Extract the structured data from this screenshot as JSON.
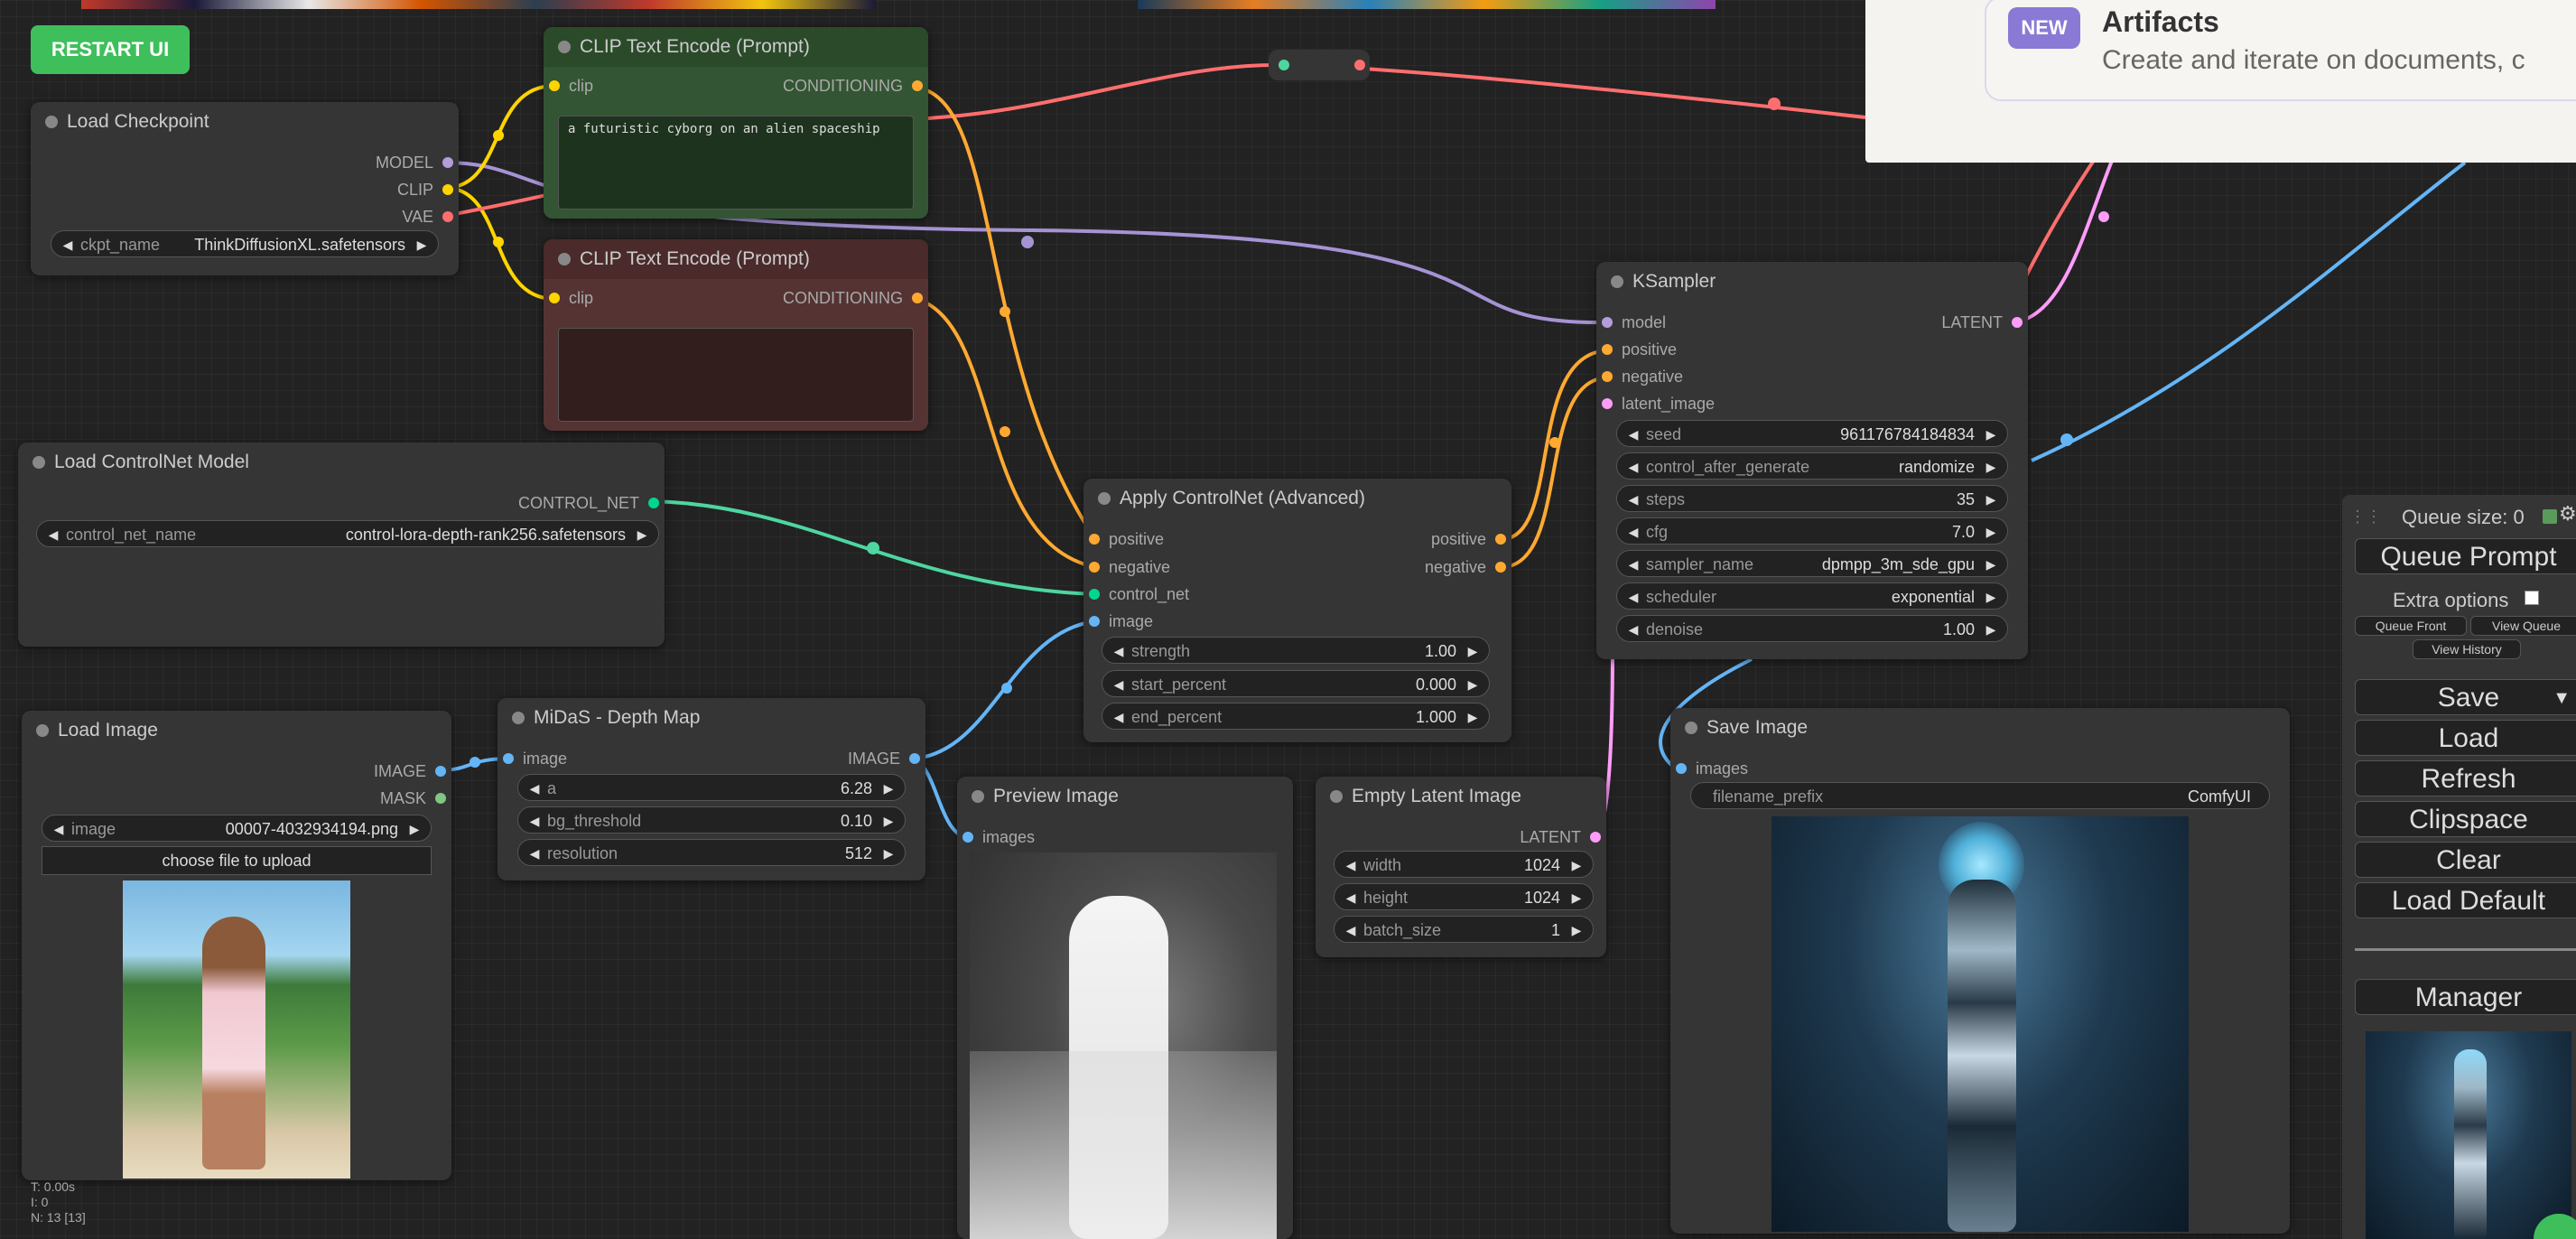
{
  "restart_button": "RESTART UI",
  "artifacts": {
    "badge": "NEW",
    "title": "Artifacts",
    "description": "Create and iterate on documents, c"
  },
  "nodes": {
    "load_checkpoint": {
      "title": "Load Checkpoint",
      "outputs": [
        "MODEL",
        "CLIP",
        "VAE"
      ],
      "widget_name": "ckpt_name",
      "widget_value": "ThinkDiffusionXL.safetensors"
    },
    "clip_pos": {
      "title": "CLIP Text Encode (Prompt)",
      "input": "clip",
      "output": "CONDITIONING",
      "text": "a futuristic cyborg on an alien spaceship"
    },
    "clip_neg": {
      "title": "CLIP Text Encode (Prompt)",
      "input": "clip",
      "output": "CONDITIONING",
      "text": ""
    },
    "load_controlnet": {
      "title": "Load ControlNet Model",
      "output": "CONTROL_NET",
      "widget_name": "control_net_name",
      "widget_value": "control-lora-depth-rank256.safetensors"
    },
    "apply_controlnet": {
      "title": "Apply ControlNet (Advanced)",
      "inputs": [
        "positive",
        "negative",
        "control_net",
        "image"
      ],
      "outputs": [
        "positive",
        "negative"
      ],
      "widgets": [
        {
          "name": "strength",
          "value": "1.00"
        },
        {
          "name": "start_percent",
          "value": "0.000"
        },
        {
          "name": "end_percent",
          "value": "1.000"
        }
      ]
    },
    "ksampler": {
      "title": "KSampler",
      "inputs": [
        "model",
        "positive",
        "negative",
        "latent_image"
      ],
      "output": "LATENT",
      "widgets": [
        {
          "name": "seed",
          "value": "961176784184834"
        },
        {
          "name": "control_after_generate",
          "value": "randomize"
        },
        {
          "name": "steps",
          "value": "35"
        },
        {
          "name": "cfg",
          "value": "7.0"
        },
        {
          "name": "sampler_name",
          "value": "dpmpp_3m_sde_gpu"
        },
        {
          "name": "scheduler",
          "value": "exponential"
        },
        {
          "name": "denoise",
          "value": "1.00"
        }
      ]
    },
    "load_image": {
      "title": "Load Image",
      "outputs": [
        "IMAGE",
        "MASK"
      ],
      "widget_name": "image",
      "widget_value": "00007-4032934194.png",
      "upload_label": "choose file to upload"
    },
    "midas": {
      "title": "MiDaS - Depth Map",
      "input": "image",
      "output": "IMAGE",
      "widgets": [
        {
          "name": "a",
          "value": "6.28"
        },
        {
          "name": "bg_threshold",
          "value": "0.10"
        },
        {
          "name": "resolution",
          "value": "512"
        }
      ]
    },
    "preview_image": {
      "title": "Preview Image",
      "input": "images"
    },
    "empty_latent": {
      "title": "Empty Latent Image",
      "output": "LATENT",
      "widgets": [
        {
          "name": "width",
          "value": "1024"
        },
        {
          "name": "height",
          "value": "1024"
        },
        {
          "name": "batch_size",
          "value": "1"
        }
      ]
    },
    "save_image": {
      "title": "Save Image",
      "input": "images",
      "widget_name": "filename_prefix",
      "widget_value": "ComfyUI"
    }
  },
  "queue_panel": {
    "queue_size": "Queue size: 0",
    "queue_prompt": "Queue Prompt",
    "extra_options": "Extra options",
    "queue_front": "Queue Front",
    "view_queue": "View Queue",
    "view_history": "View History",
    "save": "Save",
    "load": "Load",
    "refresh": "Refresh",
    "clipspace": "Clipspace",
    "clear": "Clear",
    "load_default": "Load Default",
    "manager": "Manager"
  },
  "stats": {
    "time": "T: 0.00s",
    "i": "I: 0",
    "n": "N: 13 [13]"
  },
  "colors": {
    "model": "#b39ddb",
    "clip": "#ffd500",
    "vae": "#ff6e6e",
    "conditioning": "#ffa931",
    "control_net": "#00d78d",
    "image": "#64b5f6",
    "latent": "#ff9cf9"
  }
}
